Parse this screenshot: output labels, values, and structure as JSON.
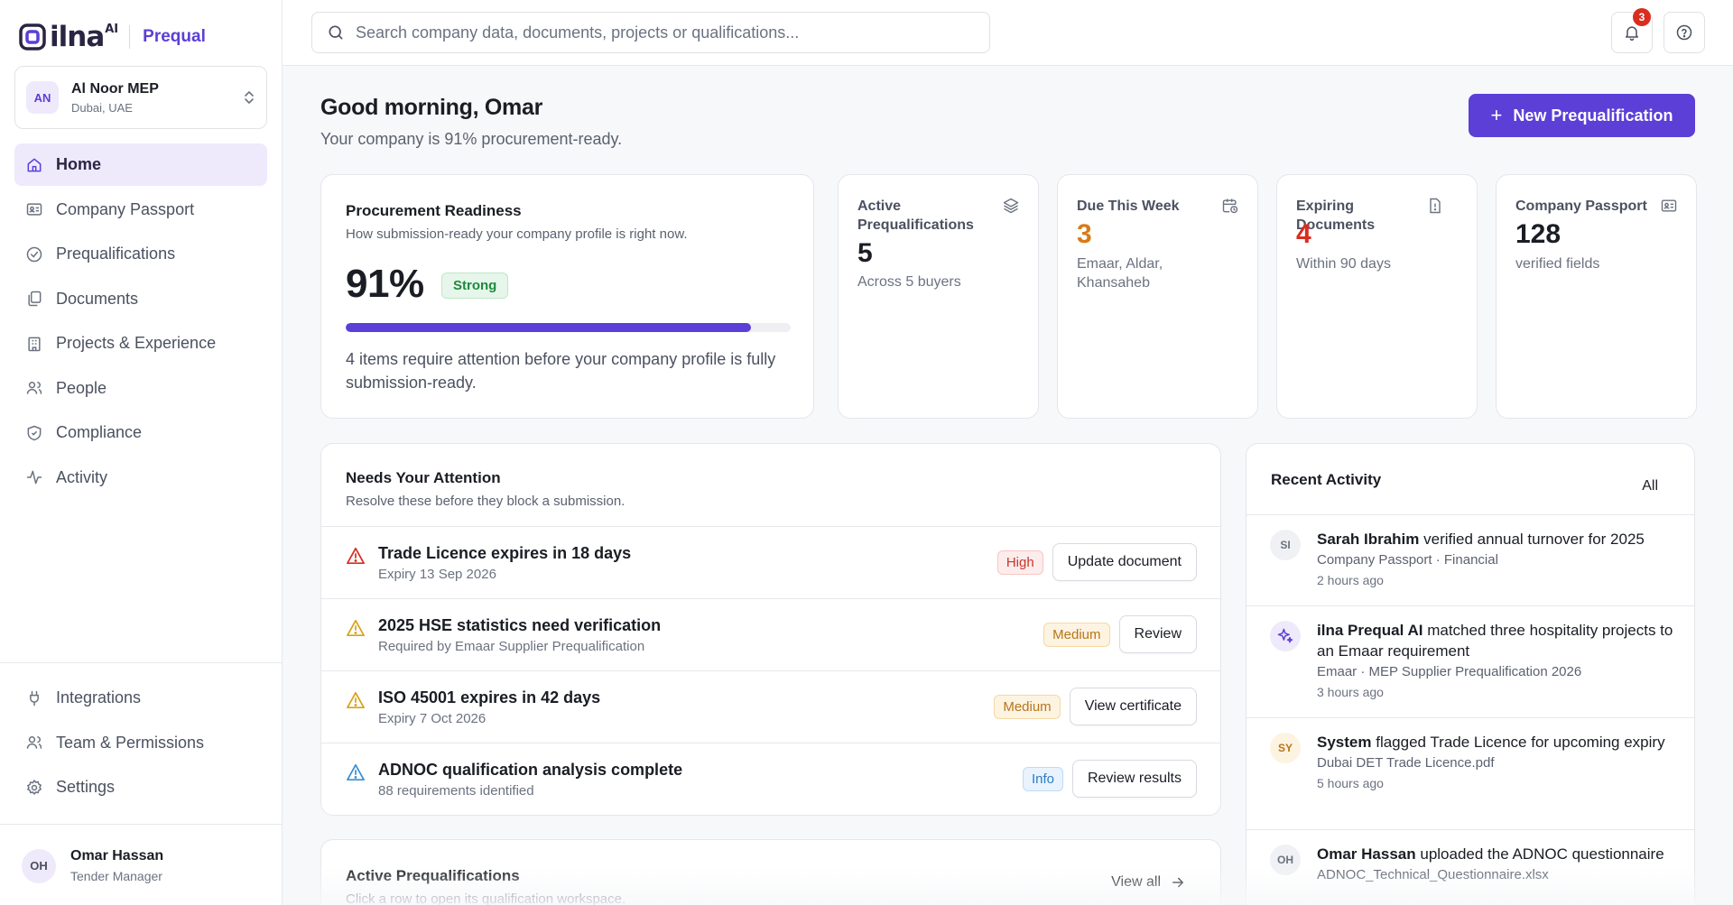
{
  "brand": {
    "name": "ilna",
    "superscript": "AI",
    "product": "Prequal"
  },
  "company": {
    "initials": "AN",
    "name": "Al Noor MEP",
    "location": "Dubai, UAE"
  },
  "nav": {
    "items": [
      {
        "label": "Home",
        "icon": "home-icon",
        "active": true
      },
      {
        "label": "Company Passport",
        "icon": "id-card-icon"
      },
      {
        "label": "Prequalifications",
        "icon": "check-circle-icon"
      },
      {
        "label": "Documents",
        "icon": "documents-icon"
      },
      {
        "label": "Projects & Experience",
        "icon": "building-icon"
      },
      {
        "label": "People",
        "icon": "people-icon"
      },
      {
        "label": "Compliance",
        "icon": "shield-check-icon"
      },
      {
        "label": "Activity",
        "icon": "activity-icon"
      }
    ],
    "bottom": [
      {
        "label": "Integrations",
        "icon": "plug-icon"
      },
      {
        "label": "Team & Permissions",
        "icon": "team-icon"
      },
      {
        "label": "Settings",
        "icon": "gear-icon"
      }
    ]
  },
  "user": {
    "initials": "OH",
    "name": "Omar Hassan",
    "role": "Tender Manager"
  },
  "search": {
    "placeholder": "Search company data, documents, projects or qualifications..."
  },
  "notifications": {
    "count": "3"
  },
  "header": {
    "greeting": "Good morning, Omar",
    "subtitle": "Your company is 91% procurement-ready.",
    "new_button": "New Prequalification"
  },
  "readiness": {
    "title": "Procurement Readiness",
    "subtitle": "How submission-ready your company profile is right now.",
    "percent_label": "91%",
    "percent": 91,
    "badge": "Strong",
    "note": "4 items require attention before your company profile is fully submission-ready."
  },
  "stats": [
    {
      "label": "Active Prequalifications",
      "value": "5",
      "sub": "Across 5 buyers",
      "icon": "layers-icon",
      "color": "#1a1d24"
    },
    {
      "label": "Due This Week",
      "value": "3",
      "sub": "Emaar, Aldar, Khansaheb",
      "icon": "calendar-clock-icon",
      "color": "#d97a16"
    },
    {
      "label": "Expiring Documents",
      "value": "4",
      "sub": "Within 90 days",
      "icon": "file-alert-icon",
      "color": "#d92d20"
    },
    {
      "label": "Company Passport",
      "value": "128",
      "sub": "verified fields",
      "icon": "id-card-icon",
      "color": "#1a1d24"
    }
  ],
  "attention": {
    "title": "Needs Your Attention",
    "subtitle": "Resolve these before they block a submission.",
    "items": [
      {
        "title": "Trade Licence expires in 18 days",
        "sub": "Expiry 13 Sep 2026",
        "severity": "High",
        "action": "Update document",
        "icon_color": "#d92d20"
      },
      {
        "title": "2025 HSE statistics need verification",
        "sub": "Required by Emaar Supplier Prequalification",
        "severity": "Medium",
        "action": "Review",
        "icon_color": "#d9a21b"
      },
      {
        "title": "ISO 45001 expires in 42 days",
        "sub": "Expiry 7 Oct 2026",
        "severity": "Medium",
        "action": "View certificate",
        "icon_color": "#d9a21b"
      },
      {
        "title": "ADNOC qualification analysis complete",
        "sub": "88 requirements identified",
        "severity": "Info",
        "action": "Review results",
        "icon_color": "#3b8fd4"
      }
    ]
  },
  "activity": {
    "title": "Recent Activity",
    "filter": "All",
    "items": [
      {
        "avatar": "SI",
        "actor": "Sarah Ibrahim",
        "text": "verified annual turnover for 2025",
        "context": "Company Passport · Financial",
        "time": "2 hours ago"
      },
      {
        "avatar": "",
        "actor": "ilna Prequal AI",
        "text": "matched three hospitality projects to an Emaar requirement",
        "context": "Emaar · MEP Supplier Prequalification 2026",
        "time": "3 hours ago"
      },
      {
        "avatar": "SY",
        "actor": "System",
        "text": "flagged Trade Licence for upcoming expiry",
        "context": "Dubai DET Trade Licence.pdf",
        "time": "5 hours ago"
      },
      {
        "avatar": "OH",
        "actor": "Omar Hassan",
        "text": "uploaded the ADNOC questionnaire",
        "context": "ADNOC_Technical_Questionnaire.xlsx",
        "time": ""
      }
    ]
  },
  "active_prequals": {
    "title": "Active Prequalifications",
    "subtitle": "Click a row to open its qualification workspace.",
    "view_all": "View all"
  }
}
